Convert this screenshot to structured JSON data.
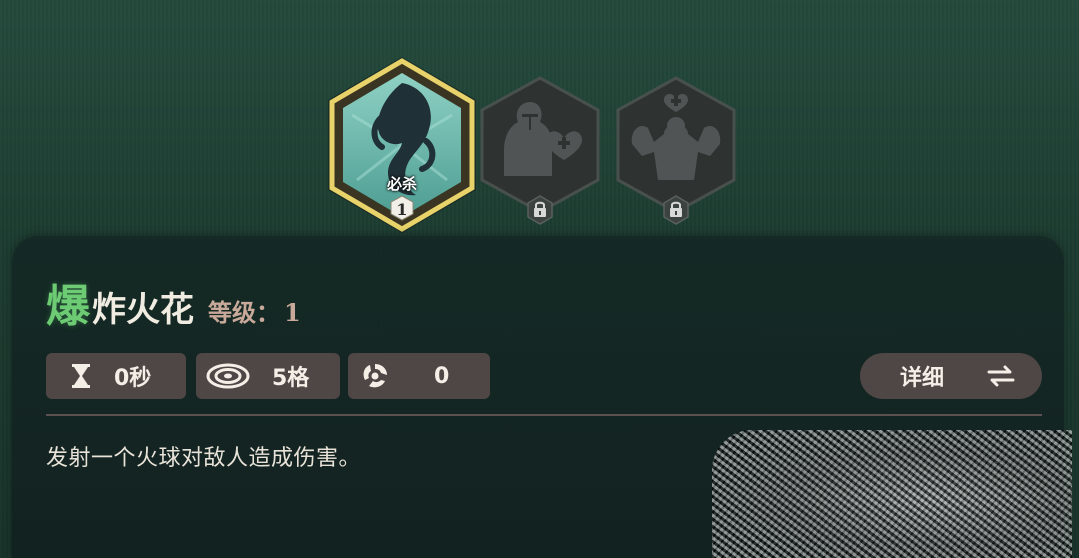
{
  "skills": [
    {
      "name": "burst-spark",
      "badge_label": "必杀",
      "level": "1",
      "selected": true,
      "icon": "fire-swirl-icon",
      "locked": false
    },
    {
      "name": "knight-heal",
      "icon": "knight-heart-plus-icon",
      "locked": true,
      "lock_icon": "lock-icon"
    },
    {
      "name": "warrior-heal",
      "icon": "warrior-heart-plus-icon",
      "locked": true,
      "lock_icon": "lock-icon"
    }
  ],
  "panel": {
    "title_first": "爆",
    "title_rest": "炸火花",
    "level_label": "等级：",
    "level_value": "1",
    "stats": {
      "cooldown": {
        "icon": "hourglass-icon",
        "value": "0秒"
      },
      "range": {
        "icon": "range-target-icon",
        "value": "5格"
      },
      "count": {
        "icon": "swirl-icon",
        "value": "0"
      }
    },
    "detail_button": {
      "label": "详细",
      "icon": "swap-arrows-icon"
    },
    "description": "发射一个火球对敌人造成伤害。"
  },
  "colors": {
    "title_accent": "#6dcb73",
    "title_text": "#f1ece2",
    "level_text": "#c9a99a",
    "stat_box": "#4f4646",
    "selected_frame": "#e8d26a"
  }
}
